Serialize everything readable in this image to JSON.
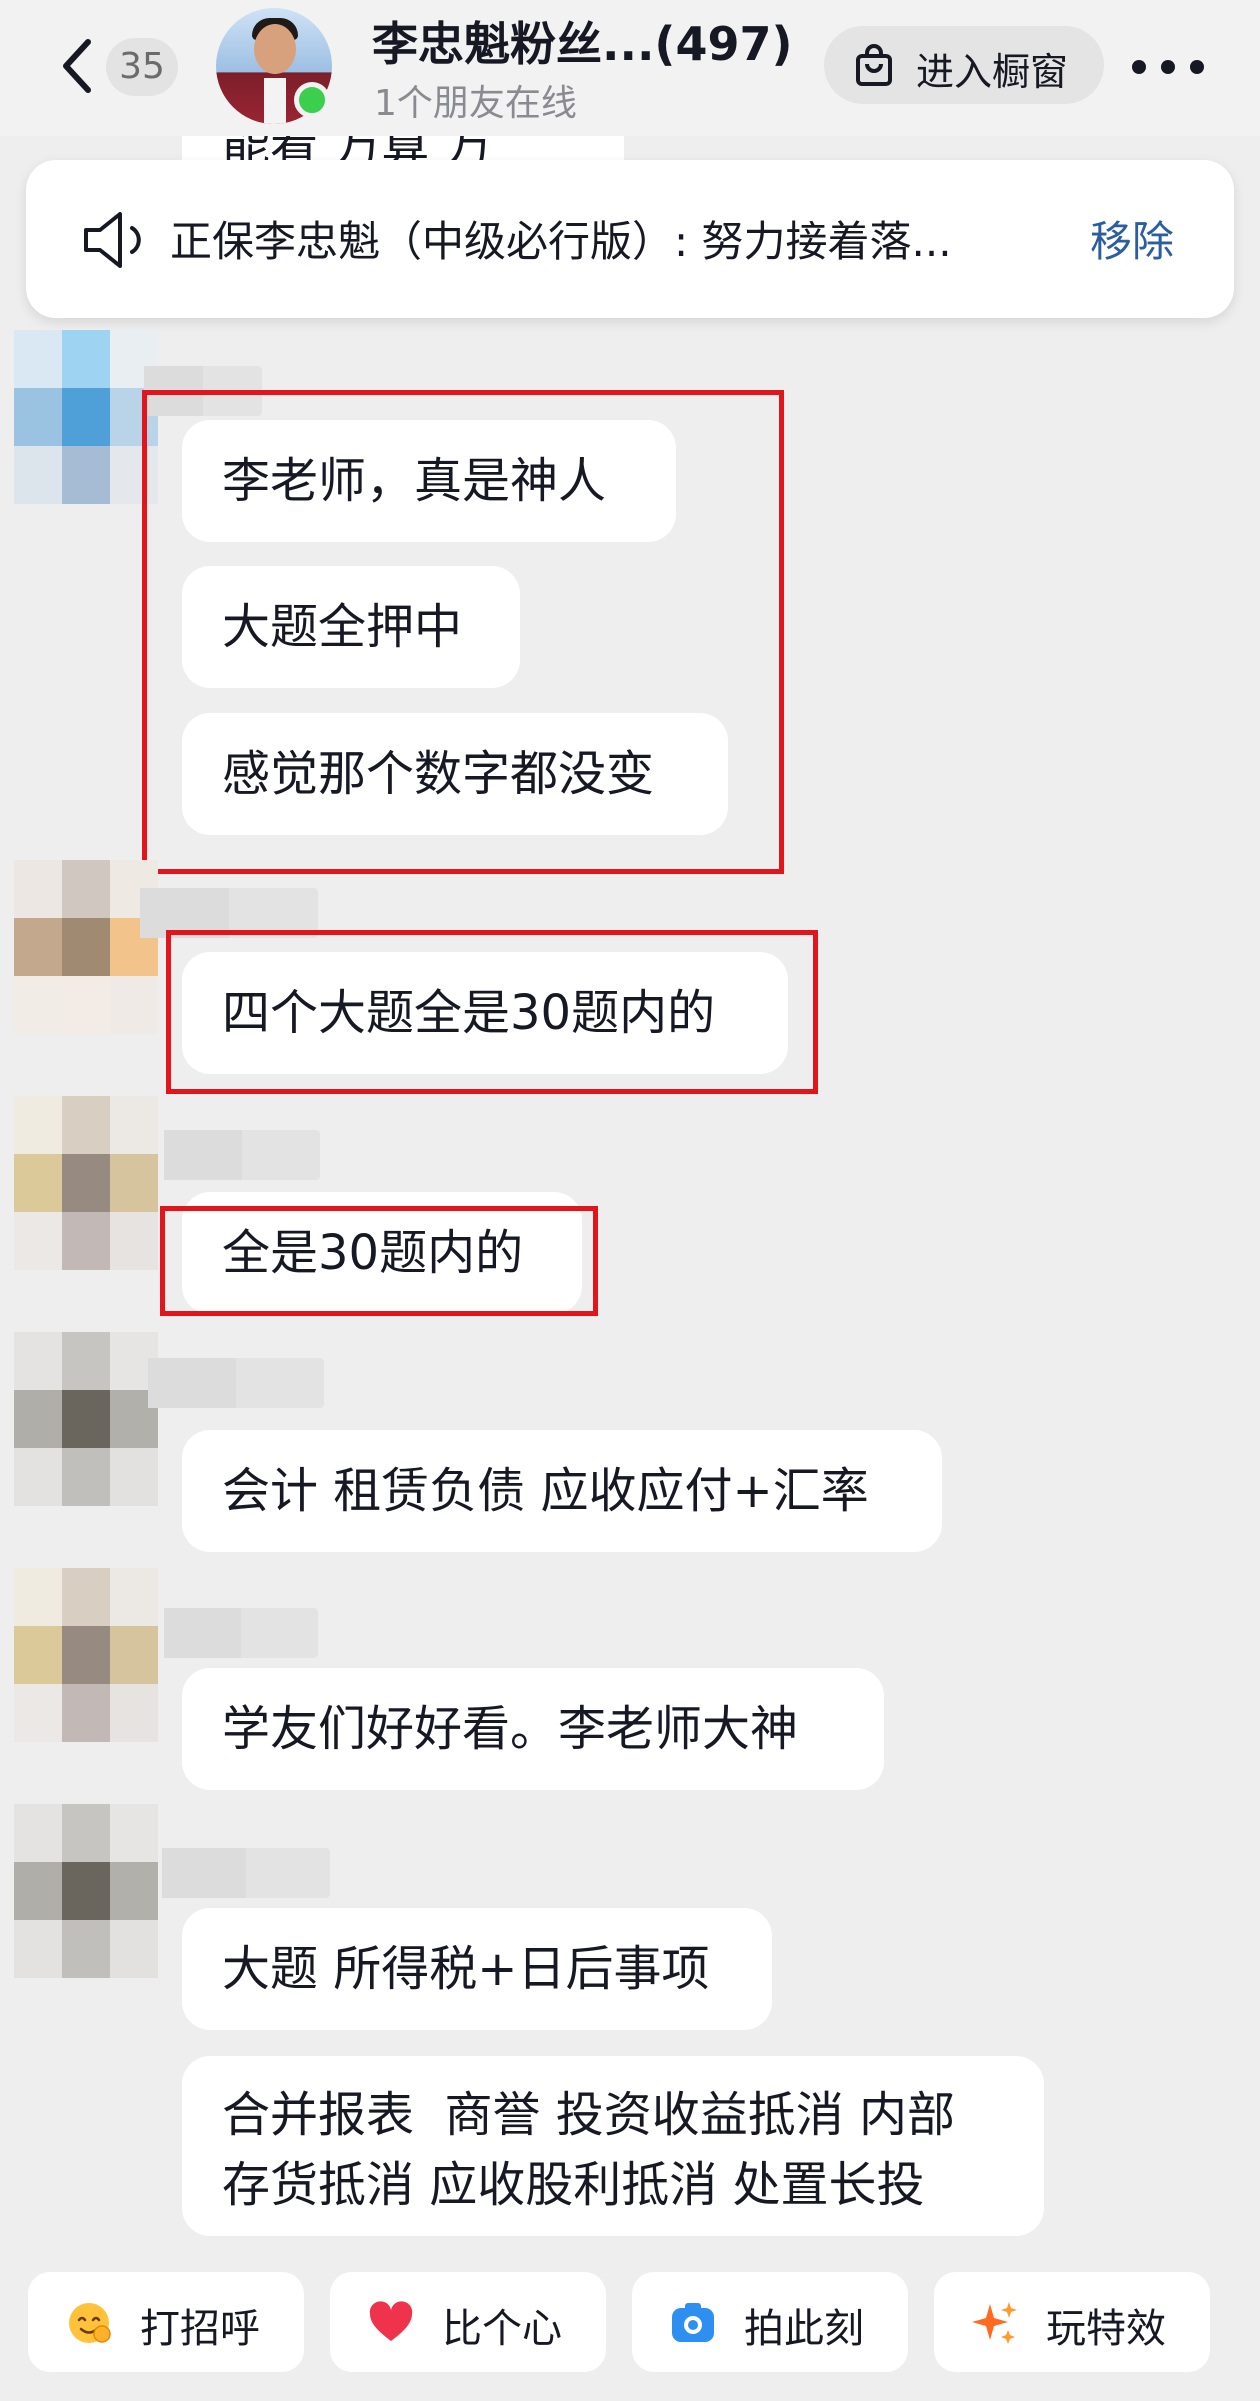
{
  "header": {
    "unread_count": "35",
    "title": "李忠魁粉丝...(497)",
    "subtitle": "1个朋友在线",
    "shop_button": "进入橱窗",
    "icons": [
      "back-icon",
      "bag-icon",
      "more-icon"
    ]
  },
  "scrolled_bubble_text": "能看  万算  万",
  "notice": {
    "text": "正保李忠魁（中级必行版）:  努力接着落...",
    "remove_label": "移除"
  },
  "messages": [
    {
      "group": 1,
      "text": "李老师，真是神人"
    },
    {
      "group": 1,
      "text": "大题全押中"
    },
    {
      "group": 1,
      "text": "感觉那个数字都没变"
    },
    {
      "group": 2,
      "text": "四个大题全是30题内的"
    },
    {
      "group": 3,
      "text": "全是30题内的"
    },
    {
      "group": 4,
      "text": "会计 租赁负债 应收应付+汇率"
    },
    {
      "group": 5,
      "text": "学友们好好看。李老师大神"
    },
    {
      "group": 6,
      "text": "大题 所得税+日后事项"
    },
    {
      "group": 6,
      "text": "合并报表  商誉 投资收益抵消 内部\n存货抵消 应收股利抵消 处置长投"
    }
  ],
  "quick_actions": [
    {
      "label": "打招呼",
      "icon": "wave-emoji-icon"
    },
    {
      "label": "比个心",
      "icon": "heart-icon"
    },
    {
      "label": "拍此刻",
      "icon": "camera-icon"
    },
    {
      "label": "玩特效",
      "icon": "sparkle-icon"
    }
  ],
  "colors": {
    "background": "#eeeeee",
    "bubble": "#ffffff",
    "highlight_box": "#e2141c",
    "remove_link": "#2a5ea0",
    "online": "#3ccf4e"
  }
}
